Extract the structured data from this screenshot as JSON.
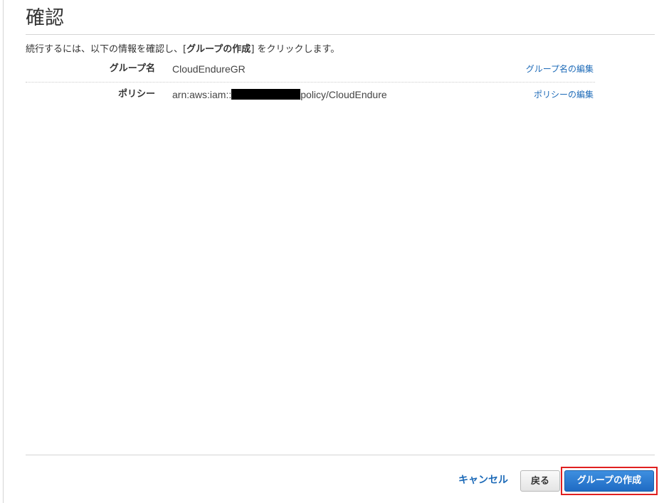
{
  "page": {
    "title": "確認"
  },
  "instruction": {
    "prefix": "続行するには、以下の情報を確認し、[",
    "emphasis": "グループの作成",
    "suffix": "] をクリックします。"
  },
  "review": {
    "rows": [
      {
        "label": "グループ名",
        "value_prefix": "CloudEndureGR",
        "value_suffix": "",
        "redacted": false,
        "edit_label": "グループ名の編集"
      },
      {
        "label": "ポリシー",
        "value_prefix": "arn:aws:iam::",
        "value_suffix": "policy/CloudEndure",
        "redacted": true,
        "edit_label": "ポリシーの編集"
      }
    ]
  },
  "footer": {
    "cancel_label": "キャンセル",
    "back_label": "戻る",
    "create_label": "グループの作成"
  },
  "colors": {
    "link": "#1e6bb8",
    "primary_button": "#1f6bc4",
    "highlight": "#e02020",
    "redaction": "#000000"
  }
}
